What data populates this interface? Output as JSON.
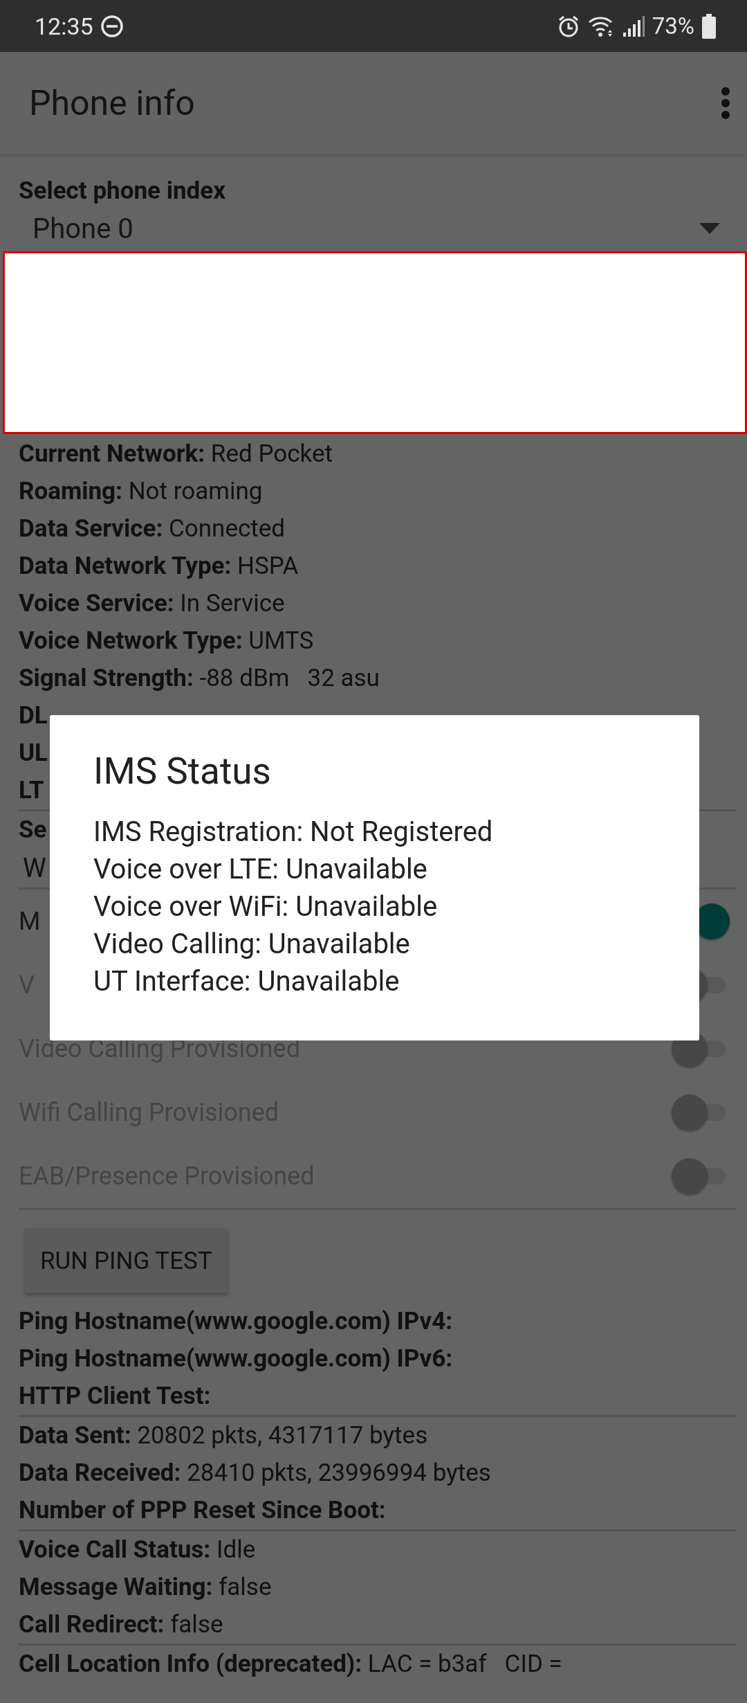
{
  "status_bar": {
    "time": "12:35",
    "battery": "73%"
  },
  "app_bar": {
    "title": "Phone info"
  },
  "phone_index": {
    "label": "Select phone index",
    "value": "Phone 0"
  },
  "info_rows": [
    {
      "kind": "field",
      "text": "**Current Network:** Red Pocket"
    },
    {
      "kind": "field",
      "text": "**Roaming:** Not roaming"
    },
    {
      "kind": "field",
      "text": "**Data Service:** Connected"
    },
    {
      "kind": "field",
      "text": "**Data Network Type:** HSPA"
    },
    {
      "kind": "field",
      "text": "**Voice Service:** In Service"
    },
    {
      "kind": "field",
      "text": "**Voice Network Type:** UMTS"
    },
    {
      "kind": "field",
      "text": "**Signal Strength:** -88 dBm   32 asu"
    },
    {
      "kind": "heading",
      "text": "DL"
    },
    {
      "kind": "heading",
      "text": "UL"
    },
    {
      "kind": "heading",
      "text": "LT"
    }
  ],
  "network_type": {
    "label": "Se",
    "value": "W"
  },
  "switches": [
    {
      "label": "M",
      "on": true,
      "disabled": false
    },
    {
      "label": "V",
      "on": false,
      "disabled": true
    },
    {
      "label": "Video Calling Provisioned",
      "on": false,
      "disabled": true
    },
    {
      "label": "Wifi Calling Provisioned",
      "on": false,
      "disabled": true
    },
    {
      "label": "EAB/Presence Provisioned",
      "on": false,
      "disabled": true
    }
  ],
  "ping_button": "RUN PING TEST",
  "result_groups": [
    [
      {
        "kind": "heading",
        "text": "Ping Hostname(www.google.com) IPv4:"
      },
      {
        "kind": "heading",
        "text": "Ping Hostname(www.google.com) IPv6:"
      },
      {
        "kind": "heading",
        "text": "HTTP Client Test:"
      }
    ],
    [
      {
        "kind": "field",
        "text": "**Data Sent:** 20802 pkts, 4317117 bytes"
      },
      {
        "kind": "field",
        "text": "**Data Received:** 28410 pkts, 23996994 bytes"
      },
      {
        "kind": "heading",
        "text": "Number of PPP Reset Since Boot:"
      }
    ],
    [
      {
        "kind": "field",
        "text": "**Voice Call Status:** Idle"
      },
      {
        "kind": "field",
        "text": "**Message Waiting:** false"
      },
      {
        "kind": "field",
        "text": "**Call Redirect:** false"
      }
    ],
    [
      {
        "kind": "field",
        "text": "**Cell Location Info (deprecated):** LAC = b3af   CID ="
      }
    ]
  ],
  "dialog": {
    "title": "IMS Status",
    "lines": [
      "IMS Registration: Not Registered",
      "Voice over LTE: Unavailable",
      "Voice over WiFi: Unavailable",
      "Video Calling: Unavailable",
      "UT Interface: Unavailable"
    ]
  }
}
